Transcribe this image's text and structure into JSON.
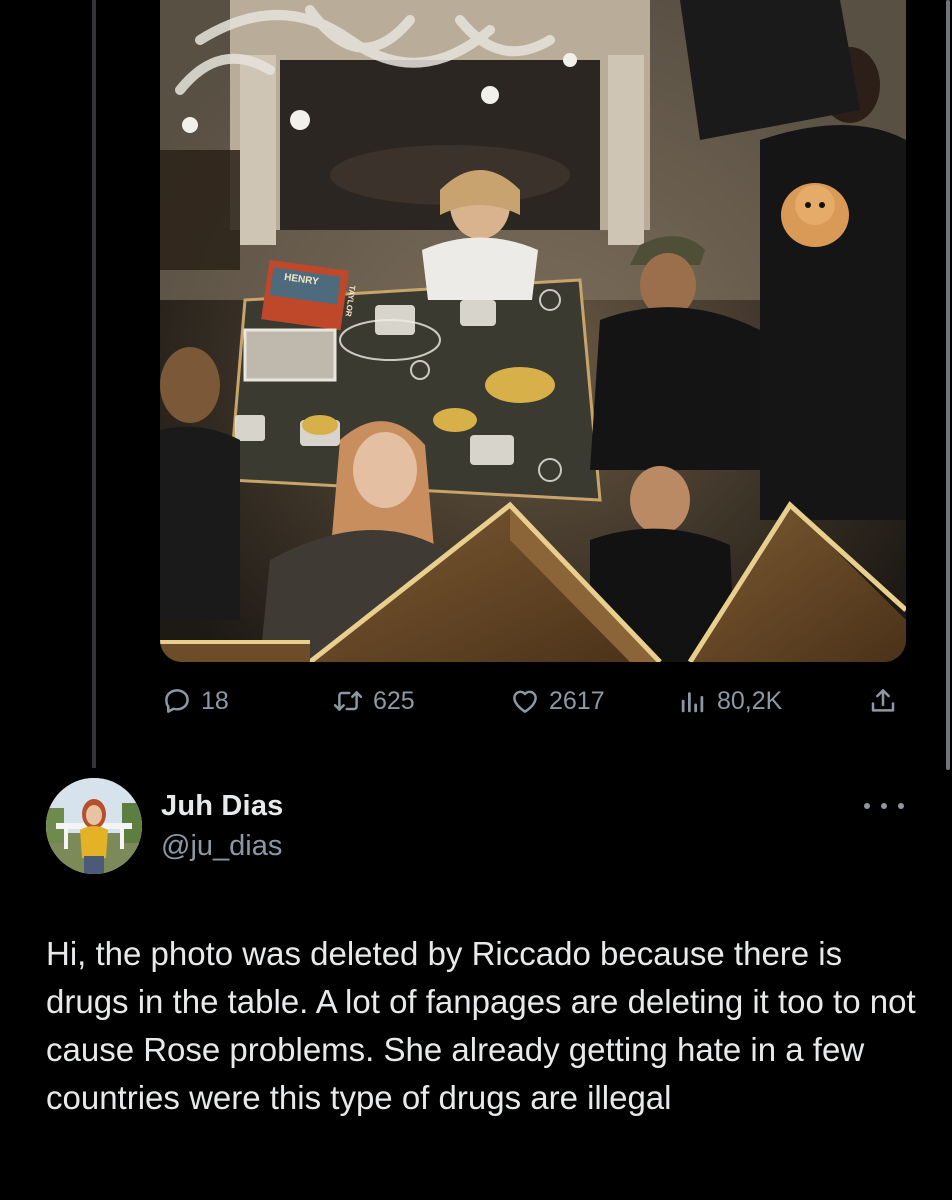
{
  "previous_tweet": {
    "photo": {
      "book_cover_text": "HENRY",
      "book_spine_text": "TAYLOR"
    },
    "actions": {
      "replies": "18",
      "retweets": "625",
      "likes": "2617",
      "views": "80,2K"
    }
  },
  "reply_tweet": {
    "author": {
      "name": "Juh Dias",
      "handle": "@ju_dias"
    },
    "text": "Hi, the photo was deleted by Riccado because there is drugs in the table. A lot of fanpages are deleting it too to not cause Rose problems. She already getting hate in a few countries were this type of drugs are illegal"
  },
  "colors": {
    "background": "#000000",
    "text_primary": "#e7e9ea",
    "text_secondary": "#8b98a5",
    "thread_line": "#333639"
  },
  "icons": [
    "reply-icon",
    "retweet-icon",
    "like-icon",
    "views-icon",
    "share-icon",
    "more-icon"
  ]
}
